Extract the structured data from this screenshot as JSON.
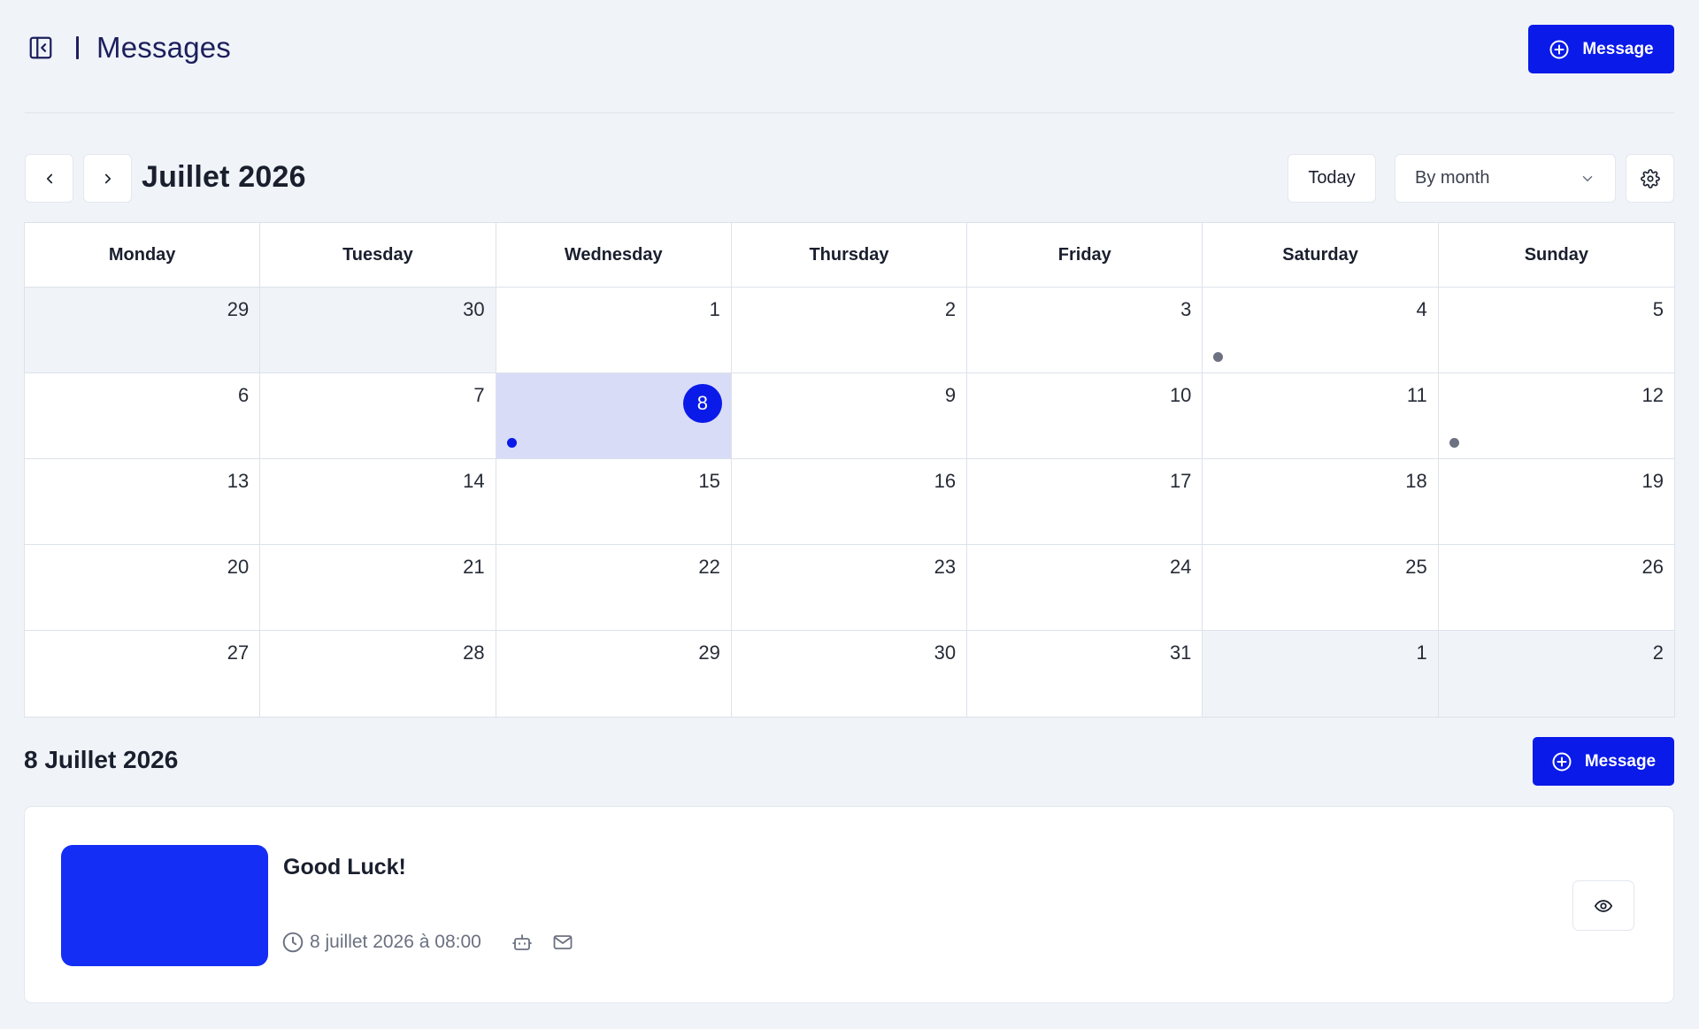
{
  "header": {
    "title": "Messages",
    "new_message_label": "Message"
  },
  "toolbar": {
    "month_label": "Juillet 2026",
    "today_label": "Today",
    "view_select_value": "By month"
  },
  "calendar": {
    "weekdays": [
      "Monday",
      "Tuesday",
      "Wednesday",
      "Thursday",
      "Friday",
      "Saturday",
      "Sunday"
    ],
    "weeks": [
      [
        {
          "day": "29",
          "muted": true
        },
        {
          "day": "30",
          "muted": true
        },
        {
          "day": "1"
        },
        {
          "day": "2"
        },
        {
          "day": "3"
        },
        {
          "day": "4",
          "event": "grey"
        },
        {
          "day": "5"
        }
      ],
      [
        {
          "day": "6"
        },
        {
          "day": "7"
        },
        {
          "day": "8",
          "selected": true,
          "event": "accent"
        },
        {
          "day": "9"
        },
        {
          "day": "10"
        },
        {
          "day": "11"
        },
        {
          "day": "12",
          "event": "grey"
        }
      ],
      [
        {
          "day": "13"
        },
        {
          "day": "14"
        },
        {
          "day": "15"
        },
        {
          "day": "16"
        },
        {
          "day": "17"
        },
        {
          "day": "18"
        },
        {
          "day": "19"
        }
      ],
      [
        {
          "day": "20"
        },
        {
          "day": "21"
        },
        {
          "day": "22"
        },
        {
          "day": "23"
        },
        {
          "day": "24"
        },
        {
          "day": "25"
        },
        {
          "day": "26"
        }
      ],
      [
        {
          "day": "27"
        },
        {
          "day": "28"
        },
        {
          "day": "29"
        },
        {
          "day": "30"
        },
        {
          "day": "31"
        },
        {
          "day": "1",
          "muted": true
        },
        {
          "day": "2",
          "muted": true
        }
      ]
    ]
  },
  "day_section": {
    "title": "8 Juillet 2026",
    "new_message_label": "Message"
  },
  "message": {
    "title": "Good Luck!",
    "datetime": "8 juillet 2026 à 08:00",
    "thumbnail_color": "#152ef5"
  },
  "colors": {
    "accent": "#0a1ae8",
    "background": "#f0f4f9",
    "selected_day": "#d9dcf7",
    "event_dot": "#6c7281"
  },
  "icons": {
    "sidebar_toggle": "sidebar-collapse-icon",
    "add": "plus-circle-icon",
    "prev": "chevron-left-icon",
    "next": "chevron-right-icon",
    "dropdown": "chevron-down-icon",
    "settings": "gear-icon",
    "clock": "clock-icon",
    "robot": "robot-icon",
    "mail": "mail-icon",
    "view": "eye-icon"
  }
}
